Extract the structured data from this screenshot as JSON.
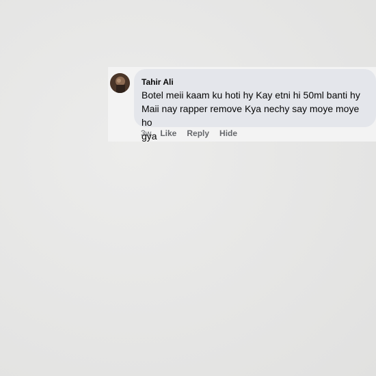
{
  "comment": {
    "author": "Tahir Ali",
    "text_line1": "Botel meii kaam ku hoti hy Kay etni hi 50ml banti hy",
    "text_line2": "Maii nay rapper remove Kya nechy say moye moye ho",
    "text_line3": "gya",
    "avatar_icon": "user-avatar-photo"
  },
  "actions": {
    "time": "3w",
    "like": "Like",
    "reply": "Reply",
    "hide": "Hide"
  },
  "colors": {
    "bubble": "#e4e6eb",
    "action_text": "#65676b",
    "text": "#050505"
  }
}
